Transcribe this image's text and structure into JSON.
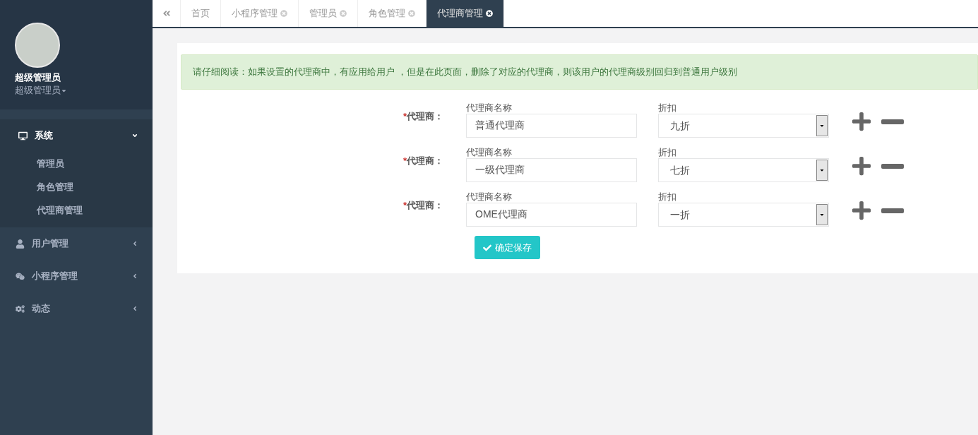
{
  "profile": {
    "name": "超级管理员",
    "role": "超级管理员"
  },
  "sidebar": {
    "items": [
      {
        "kind": "monitor",
        "label": "系统",
        "expanded": true,
        "children": [
          {
            "label": "管理员"
          },
          {
            "label": "角色管理"
          },
          {
            "label": "代理商管理"
          }
        ]
      },
      {
        "kind": "user",
        "label": "用户管理",
        "expanded": false
      },
      {
        "kind": "chat",
        "label": "小程序管理",
        "expanded": false
      },
      {
        "kind": "gears",
        "label": "动态",
        "expanded": false
      }
    ]
  },
  "tabs": [
    {
      "label": "首页",
      "selected": false,
      "closable": false
    },
    {
      "label": "小程序管理",
      "selected": false,
      "closable": true
    },
    {
      "label": "管理员",
      "selected": false,
      "closable": true
    },
    {
      "label": "角色管理",
      "selected": false,
      "closable": true
    },
    {
      "label": "代理商管理",
      "selected": true,
      "closable": true
    }
  ],
  "alert": "请仔细阅读：如果设置的代理商中，有应用给用户 ，但是在此页面，删除了对应的代理商，则该用户的代理商级别回归到普通用户级别",
  "agents": [
    {
      "required_mark": "*",
      "label": "代理商：",
      "name_label": "代理商名称",
      "name_value": "普通代理商",
      "discount_label": "折扣",
      "discount_value": "九折"
    },
    {
      "required_mark": "*",
      "label": "代理商：",
      "name_label": "代理商名称",
      "name_value": "一级代理商",
      "discount_label": "折扣",
      "discount_value": "七折"
    },
    {
      "required_mark": "*",
      "label": "代理商：",
      "name_label": "代理商名称",
      "name_value": "OME代理商",
      "discount_label": "折扣",
      "discount_value": "一折"
    }
  ],
  "save_button": "确定保存"
}
